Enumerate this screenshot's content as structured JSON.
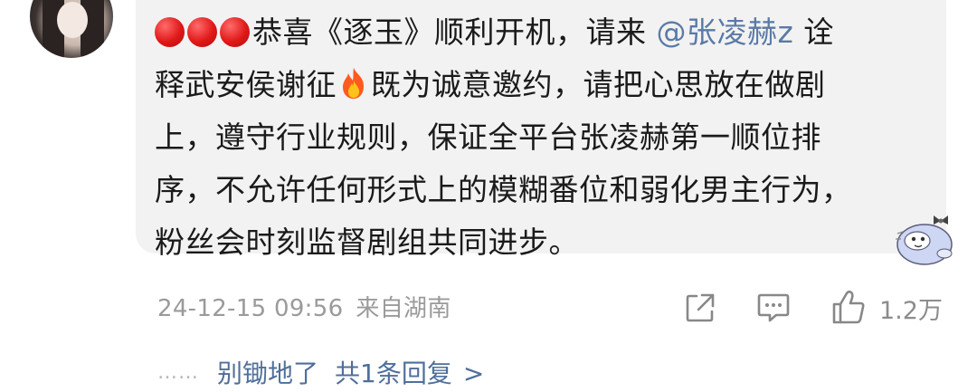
{
  "comment": {
    "prefix": "恭喜《逐玉》顺利开机，请来",
    "mention": "@张凌赫z",
    "line_a_tail": " 诠",
    "line_b_head": "释武安侯谢征",
    "line_b_tail": "既为诚意邀约，请把心思放在做剧",
    "line_c": "上，遵守行业规则，保证全平台张凌赫第一顺位排",
    "line_d": "序，不允许任何形式上的模糊番位和弱化男主行为，",
    "line_e": "粉丝会时刻监督剧组共同进步。",
    "emoji_leading": [
      "red-circle",
      "red-circle",
      "red-circle"
    ],
    "emoji_inline": "fire-icon",
    "sticker_icon": "cartoon-sticker-icon"
  },
  "meta": {
    "timestamp": "24-12-15 09:56",
    "location": "来自湖南",
    "like_count": "1.2万"
  },
  "reply": {
    "dots": "……",
    "replier": "别锄地了",
    "summary": "共1条回复",
    "chevron": ">"
  },
  "colors": {
    "bubble_bg": "#f2f2f2",
    "mention": "#5a7aa6",
    "link": "#4f6f9b",
    "meta": "#9a9a9a"
  }
}
